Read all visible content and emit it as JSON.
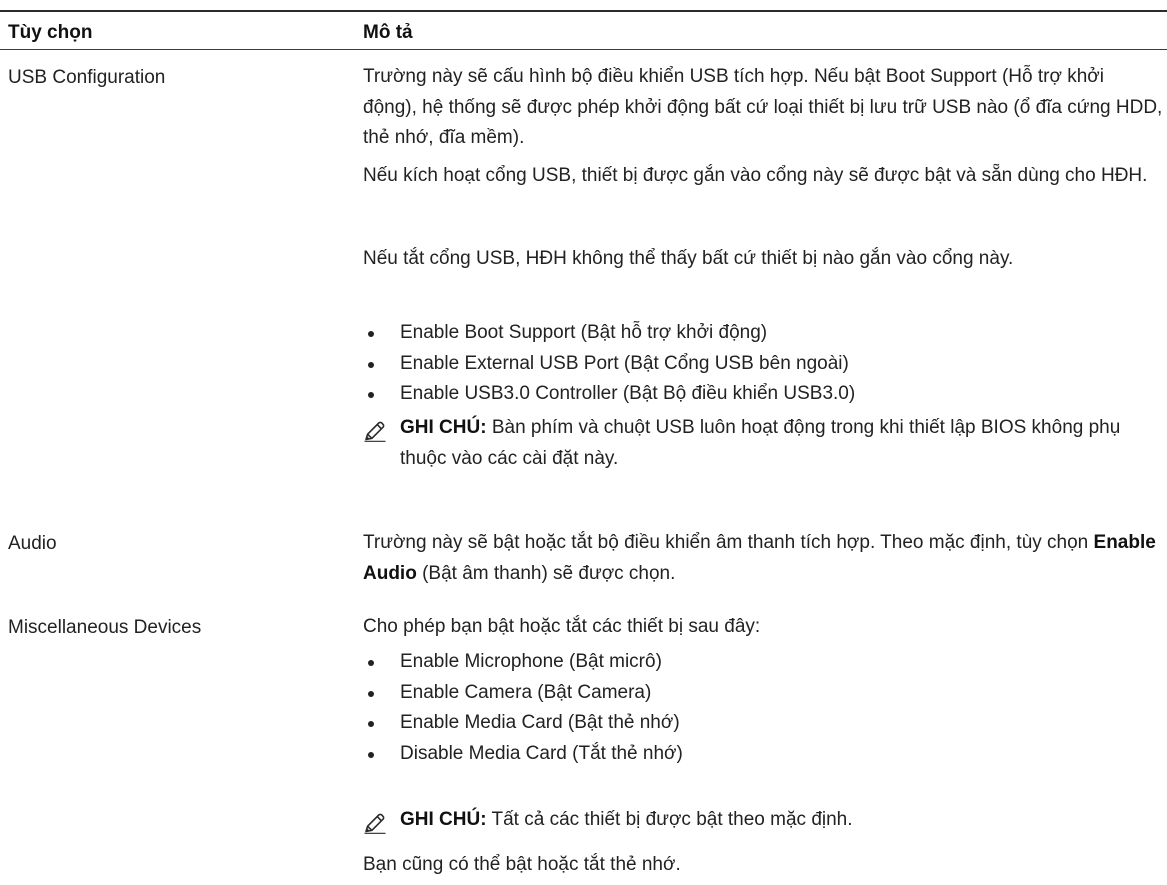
{
  "table": {
    "headers": {
      "option": "Tùy chọn",
      "description": "Mô tả"
    },
    "rows": [
      {
        "option": "USB Configuration",
        "paragraphs": [
          "Trường này sẽ cấu hình bộ điều khiển USB tích hợp. Nếu bật Boot Support (Hỗ trợ khởi động), hệ thống sẽ được phép khởi động bất cứ loại thiết bị lưu trữ USB nào (ổ đĩa cứng HDD, thẻ nhớ, đĩa mềm).",
          "Nếu kích hoạt cổng USB, thiết bị được gắn vào cổng này sẽ được bật và sẵn dùng cho HĐH.",
          "Nếu tắt cổng USB, HĐH không thể thấy bất cứ thiết bị nào gắn vào cổng này."
        ],
        "bullets": [
          "Enable Boot Support (Bật hỗ trợ khởi động)",
          "Enable External USB Port (Bật Cổng USB bên ngoài)",
          "Enable USB3.0 Controller (Bật Bộ điều khiển USB3.0)"
        ],
        "note": {
          "label": "GHI CHÚ:",
          "text": " Bàn phím và chuột USB luôn hoạt động trong khi thiết lập BIOS không phụ thuộc vào các cài đặt này."
        }
      },
      {
        "option": "Audio",
        "text_before": "Trường này sẽ bật hoặc tắt bộ điều khiển âm thanh tích hợp. Theo mặc định, tùy chọn ",
        "text_bold": "Enable Audio",
        "text_after": " (Bật âm thanh) sẽ được chọn."
      },
      {
        "option": "Miscellaneous Devices",
        "intro": "Cho phép bạn bật hoặc tắt các thiết bị sau đây:",
        "bullets": [
          "Enable Microphone (Bật micrô)",
          "Enable Camera (Bật Camera)",
          "Enable Media Card (Bật thẻ nhớ)",
          "Disable Media Card (Tắt thẻ nhớ)"
        ],
        "note": {
          "label": "GHI CHÚ:",
          "text": " Tất cả các thiết bị được bật theo mặc định."
        },
        "footer": "Bạn cũng có thể bật hoặc tắt thẻ nhớ."
      }
    ]
  },
  "icons": {
    "note_icon": "pencil-icon"
  }
}
